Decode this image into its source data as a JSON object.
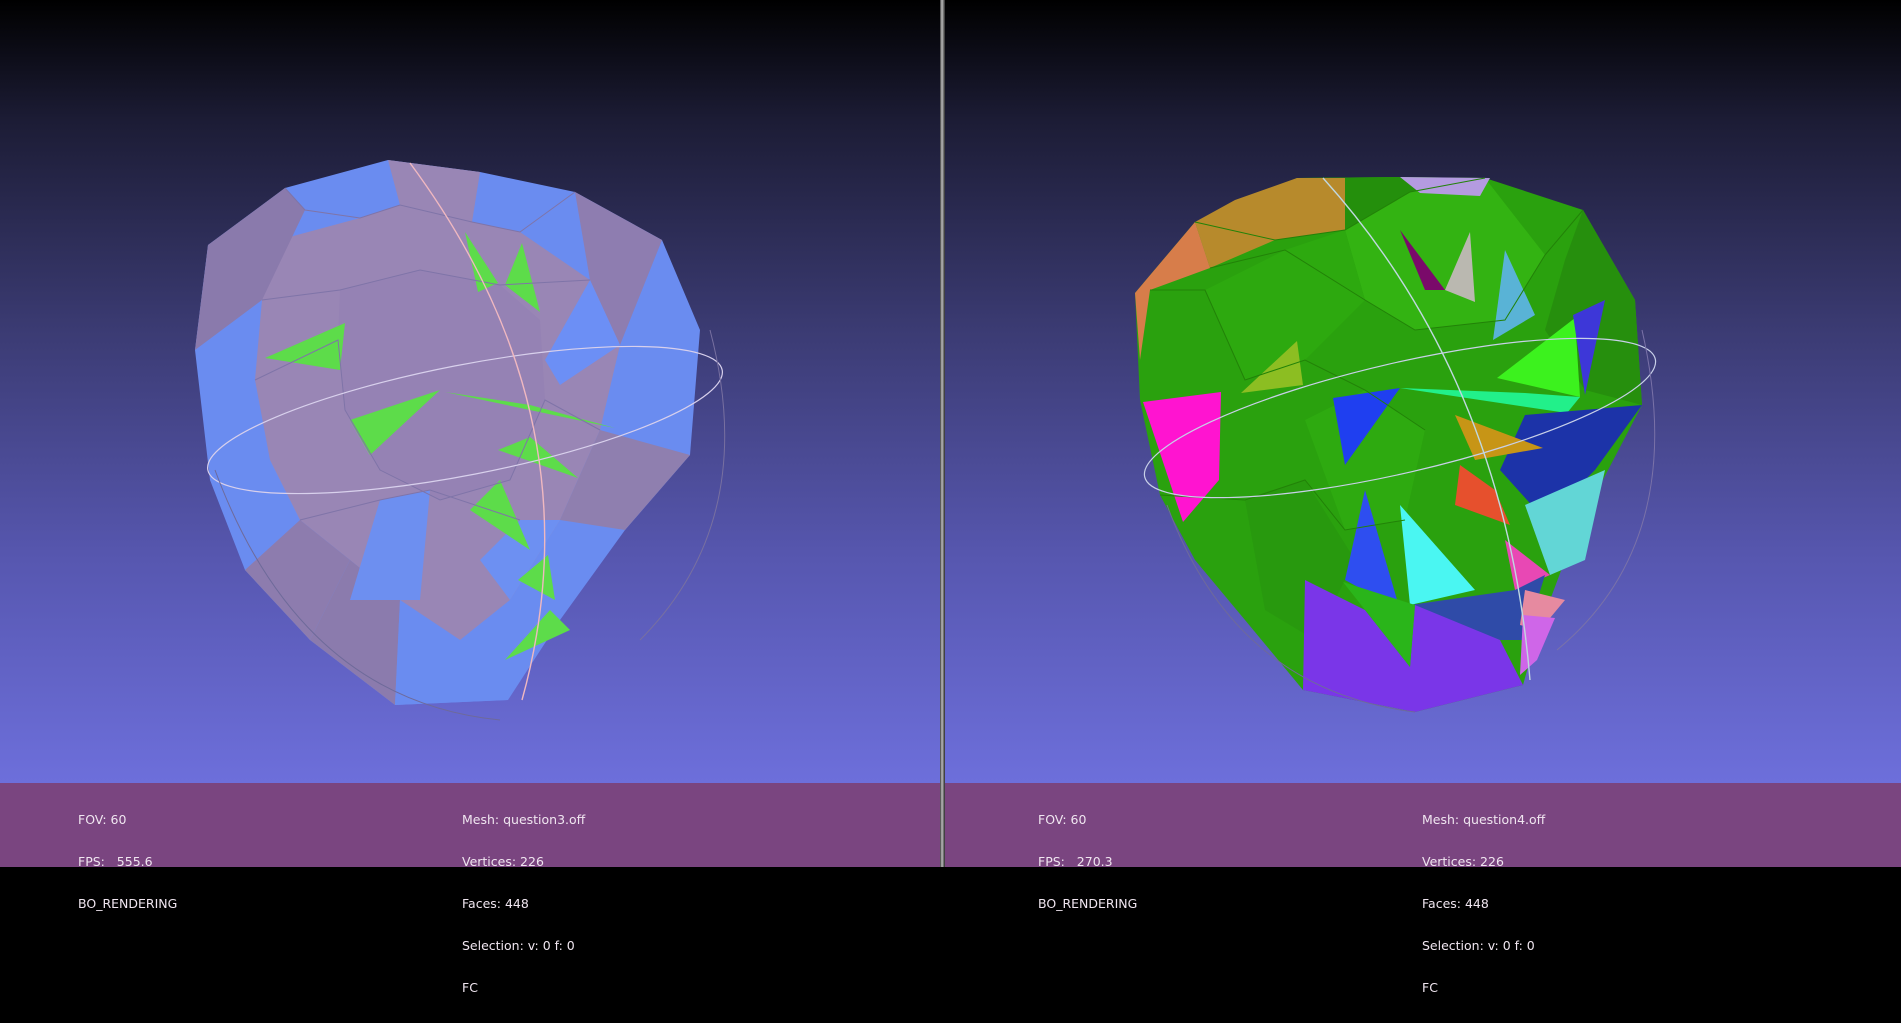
{
  "left_viewport": {
    "info_left": {
      "fov": "FOV: 60",
      "fps": "FPS:   555.6",
      "mode": "BO_RENDERING"
    },
    "info_right": {
      "mesh": "Mesh: question3.off",
      "vertices": "Vertices: 226",
      "faces": "Faces: 448",
      "selection": "Selection: v: 0 f: 0",
      "flag": "FC"
    },
    "colors": {
      "base": "#6a8cf0",
      "face": "#9c88b8",
      "accent": "#5ddc4a"
    }
  },
  "right_viewport": {
    "info_left": {
      "fov": "FOV: 60",
      "fps": "FPS:   270.3",
      "mode": "BO_RENDERING"
    },
    "info_right": {
      "mesh": "Mesh: question4.off",
      "vertices": "Vertices: 226",
      "faces": "Faces: 448",
      "selection": "Selection: v: 0 f: 0",
      "flag": "FC"
    },
    "colors": {
      "base": "#2aa10e",
      "accent": "#ff14d0"
    }
  },
  "colors": {
    "info_bar": "#7a4580",
    "background_top": "#000000",
    "background_bottom": "#6d6fdb"
  }
}
